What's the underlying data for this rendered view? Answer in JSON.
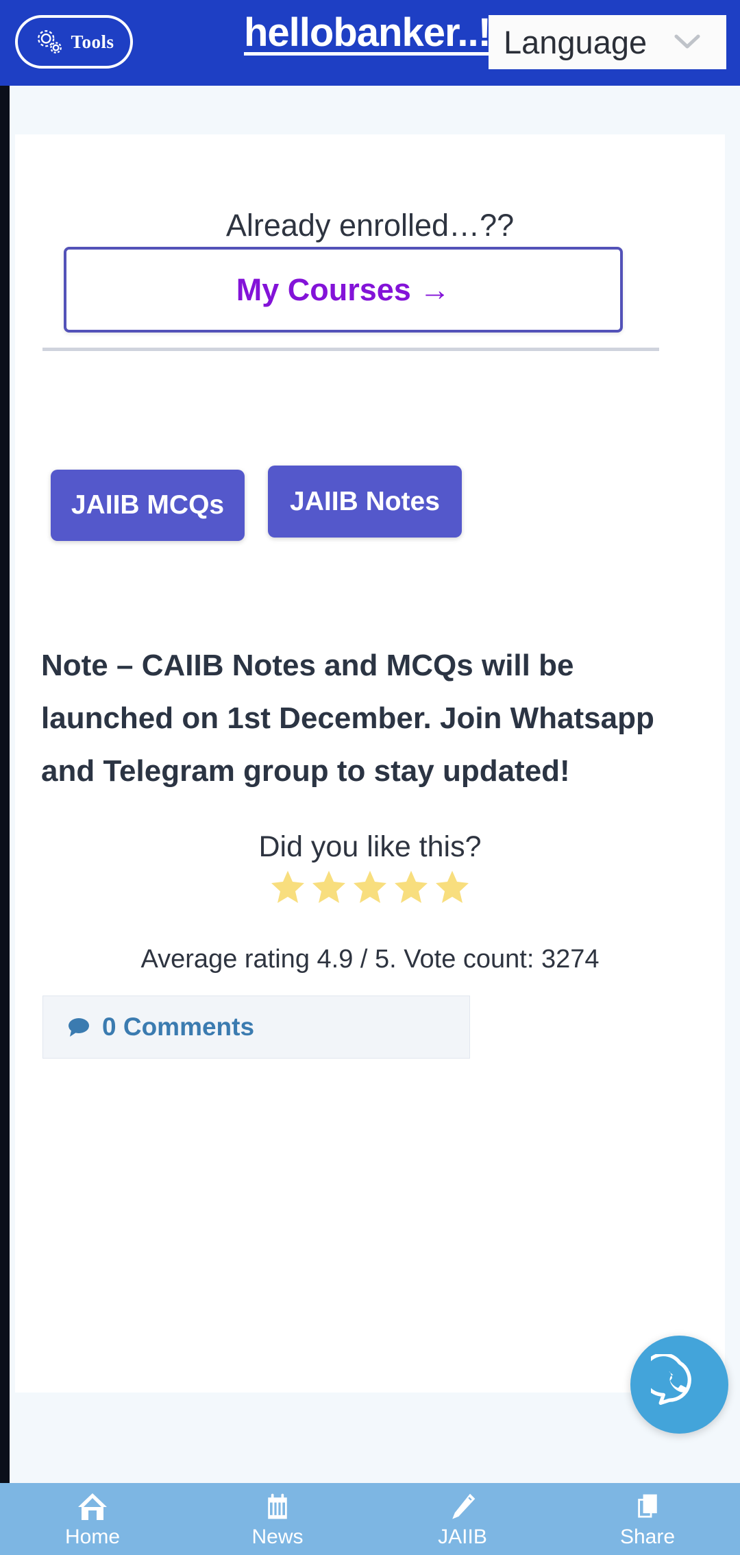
{
  "header": {
    "tools_label": "Tools",
    "tools_icon": "gears-icon",
    "site_title": "hellobanker..!",
    "language_label": "Language",
    "chevron_icon": "chevron-down-icon",
    "bg_color": "#1e3fc4"
  },
  "enrolled": {
    "prompt": "Already enrolled…??",
    "my_courses_label": "My Courses →",
    "my_courses_color": "#8313d8",
    "border_color": "#5352b8"
  },
  "quick_buttons": [
    {
      "label": "JAIIB MCQs"
    },
    {
      "label": "JAIIB Notes"
    }
  ],
  "quick_button_color": "#5458cb",
  "note": {
    "text": "Note – CAIIB Notes and MCQs will be launched on 1st December. Join Whatsapp and Telegram group to stay updated!"
  },
  "rating": {
    "question": "Did you like this?",
    "stars_filled": 5,
    "star_color": "#f8de7e",
    "summary": "Average rating 4.9 / 5. Vote count: 3274",
    "average": "4.9",
    "out_of": "5",
    "vote_count": "3274"
  },
  "comments": {
    "icon": "speech-bubble-icon",
    "label": "0 Comments",
    "count": "0",
    "color": "#3b7bb0"
  },
  "floating_action": {
    "icon": "whatsapp-icon",
    "color": "#43a4da"
  },
  "bottom_nav": {
    "bg_color": "#7db6e3",
    "items": [
      {
        "label": "Home",
        "icon": "home-icon"
      },
      {
        "label": "News",
        "icon": "calendar-icon"
      },
      {
        "label": "JAIIB",
        "icon": "pencil-icon"
      },
      {
        "label": "Share",
        "icon": "copy-icon"
      }
    ]
  }
}
